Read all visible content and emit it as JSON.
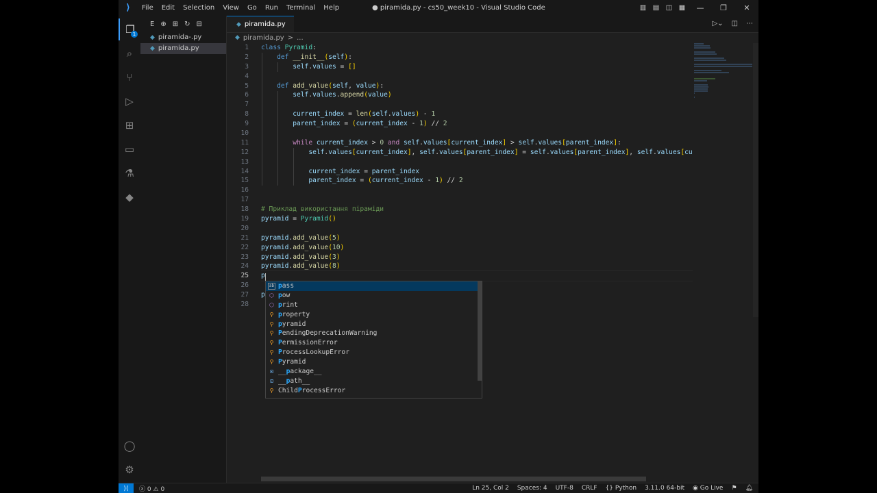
{
  "window": {
    "title": "● piramida.py - cs50_week10 - Visual Studio Code",
    "menu": [
      "File",
      "Edit",
      "Selection",
      "View",
      "Go",
      "Run",
      "Terminal",
      "Help"
    ]
  },
  "explorer": {
    "header_letter": "E",
    "files": [
      {
        "name": "piramida-.py",
        "selected": false
      },
      {
        "name": "piramida.py",
        "selected": true
      }
    ]
  },
  "activity_badge": "1",
  "editor": {
    "tab_label": "piramida.py",
    "breadcrumb_file": "piramida.py",
    "breadcrumb_sep": ">",
    "breadcrumb_more": "...",
    "current_line": 25,
    "line_numbers": [
      "1",
      "2",
      "3",
      "4",
      "5",
      "6",
      "7",
      "8",
      "9",
      "10",
      "11",
      "12",
      "13",
      "14",
      "15",
      "16",
      "17",
      "18",
      "19",
      "20",
      "21",
      "22",
      "23",
      "24",
      "25",
      "26",
      "27",
      "28"
    ],
    "lines": [
      "class Pyramid:",
      "    def __init__(self):",
      "        self.values = []",
      "",
      "    def add_value(self, value):",
      "        self.values.append(value)",
      "",
      "        current_index = len(self.values) - 1",
      "        parent_index = (current_index - 1) // 2",
      "",
      "        while current_index > 0 and self.values[current_index] > self.values[parent_index]:",
      "            self.values[current_index], self.values[parent_index] = self.values[parent_index], self.values[curre",
      "",
      "            current_index = parent_index",
      "            parent_index = (current_index - 1) // 2",
      "",
      "",
      "# Приклад використання піраміди",
      "pyramid = Pyramid()",
      "",
      "pyramid.add_value(5)",
      "pyramid.add_value(10)",
      "pyramid.add_value(3)",
      "pyramid.add_value(8)",
      "p",
      "",
      "p",
      ""
    ]
  },
  "suggest": {
    "items": [
      {
        "label": "pass",
        "kind": "keyword"
      },
      {
        "label": "pow",
        "kind": "function"
      },
      {
        "label": "print",
        "kind": "function"
      },
      {
        "label": "property",
        "kind": "class"
      },
      {
        "label": "pyramid",
        "kind": "class"
      },
      {
        "label": "PendingDeprecationWarning",
        "kind": "class"
      },
      {
        "label": "PermissionError",
        "kind": "class"
      },
      {
        "label": "ProcessLookupError",
        "kind": "class"
      },
      {
        "label": "Pyramid",
        "kind": "class"
      },
      {
        "label": "__package__",
        "kind": "variable"
      },
      {
        "label": "__path__",
        "kind": "variable"
      },
      {
        "label": "ChildProcessError",
        "kind": "class"
      }
    ]
  },
  "status": {
    "errors": "0",
    "warnings": "0",
    "position": "Ln 25, Col 2",
    "spaces": "Spaces: 4",
    "encoding": "UTF-8",
    "eol": "CRLF",
    "language": "Python",
    "interpreter": "3.11.0 64-bit",
    "golive": "Go Live"
  },
  "colors": {
    "accent": "#0078d4",
    "keyword": "#569cd6",
    "control": "#c586c0",
    "class": "#4ec9b0",
    "function": "#dcdcaa",
    "variable": "#9cdcfe",
    "number": "#b5cea8",
    "comment": "#6a9955"
  }
}
